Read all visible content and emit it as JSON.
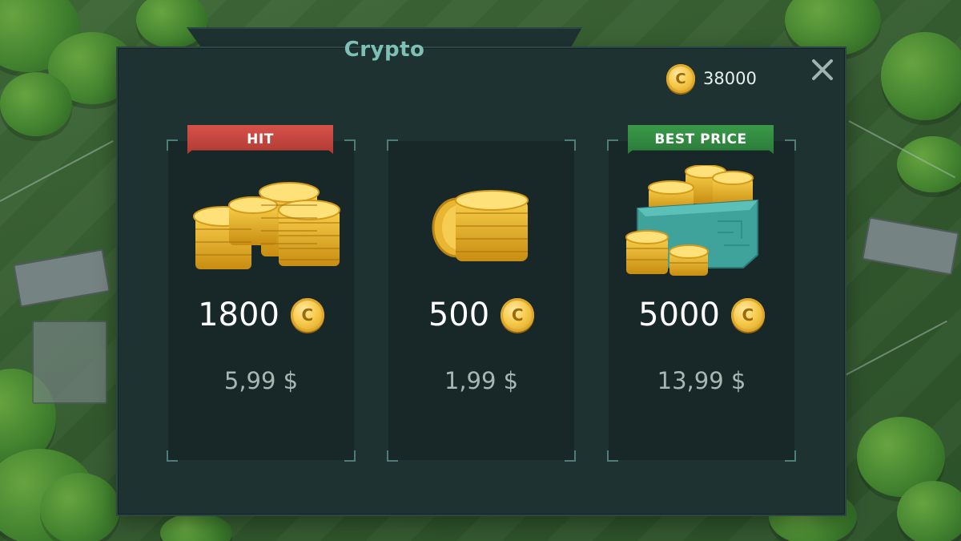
{
  "window": {
    "title": "Crypto"
  },
  "balance": {
    "amount": "38000",
    "icon": "coin-icon"
  },
  "close": {
    "icon": "close-icon"
  },
  "offers": [
    {
      "badge": "HIT",
      "badge_color": "#c4443c",
      "amount": "1800",
      "price": "5,99 $",
      "art": "coin-stacks-icon"
    },
    {
      "badge": "",
      "amount": "500",
      "price": "1,99 $",
      "art": "coin-stack-icon"
    },
    {
      "badge": "BEST PRICE",
      "badge_color": "#338a42",
      "amount": "5000",
      "price": "13,99 $",
      "art": "coin-chest-icon"
    }
  ],
  "colors": {
    "title": "#7ec0b6",
    "panel": "#1f3232",
    "card": "#182828",
    "coin": "#f6c94a"
  }
}
